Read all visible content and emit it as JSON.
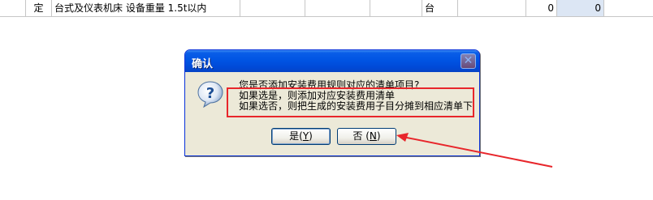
{
  "table": {
    "row": {
      "col1": "",
      "col2": "定",
      "col3": "台式及仪表机床 设备重量 1.5t以内",
      "unit": "台",
      "qty1": "0",
      "qty2": "0"
    }
  },
  "dialog": {
    "title": "确认",
    "icon": "question-icon",
    "message_line1": "您是否添加安装费用规则对应的清单项目?",
    "message_line2": "如果选是，则添加对应安装费用清单",
    "message_line3": "如果选否，则把生成的安装费用子目分摊到相应清单下",
    "yes_label": "是",
    "yes_key": "Y",
    "no_label": "否",
    "no_key": "N"
  },
  "colors": {
    "highlight": "#e8262b",
    "titlebar": "#0054e3"
  }
}
